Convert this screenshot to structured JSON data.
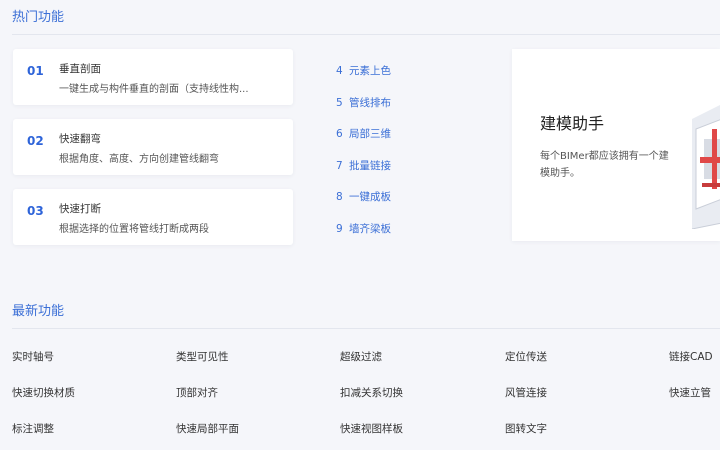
{
  "hot": {
    "title": "热门功能",
    "cards": [
      {
        "num": "01",
        "title": "垂直剖面",
        "desc": "一键生成与构件垂直的剖面（支持线性构..."
      },
      {
        "num": "02",
        "title": "快速翻弯",
        "desc": "根据角度、高度、方向创建管线翻弯"
      },
      {
        "num": "03",
        "title": "快速打断",
        "desc": "根据选择的位置将管线打断成两段"
      }
    ],
    "links": [
      {
        "idx": "4",
        "label": "元素上色"
      },
      {
        "idx": "5",
        "label": "管线排布"
      },
      {
        "idx": "6",
        "label": "局部三维"
      },
      {
        "idx": "7",
        "label": "批量链接"
      },
      {
        "idx": "8",
        "label": "一键成板"
      },
      {
        "idx": "9",
        "label": "墙齐梁板"
      }
    ],
    "promo": {
      "title": "建模助手",
      "desc": "每个BIMer都应该拥有一个建模助手。"
    }
  },
  "latest": {
    "title": "最新功能",
    "rows": [
      [
        "实时轴号",
        "类型可见性",
        "超级过滤",
        "定位传送",
        "链接CAD"
      ],
      [
        "快速切换材质",
        "顶部对齐",
        "扣减关系切换",
        "风管连接",
        "快速立管"
      ],
      [
        "标注调整",
        "快速局部平面",
        "快速视图样板",
        "图转文字"
      ]
    ]
  },
  "colors": {
    "accent": "#3b6fd6",
    "number": "#2e64d9",
    "background": "#f5f6fa"
  }
}
